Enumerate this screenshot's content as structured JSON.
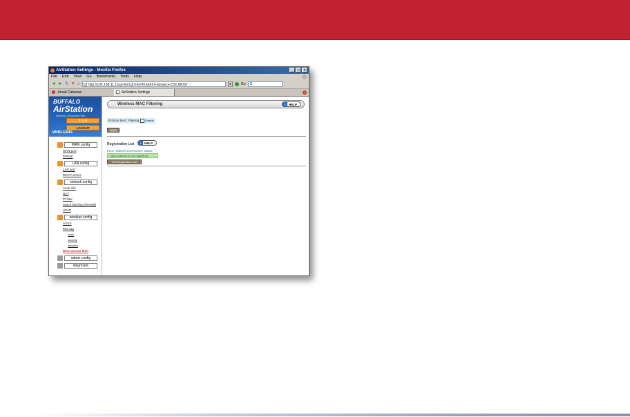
{
  "window": {
    "title": "AirStation Settings - Mozilla Firefox",
    "controls": [
      "_",
      "□",
      "×"
    ]
  },
  "menu": [
    "File",
    "Edit",
    "View",
    "Go",
    "Bookmarks",
    "Tools",
    "Help"
  ],
  "nav": {
    "back": "◄",
    "forward": "►",
    "reload": "↻",
    "stop": "✕",
    "home": "⌂",
    "url": "http://192.168.11.1/cgi-bin/cgi?req=frm&frm=advance-DSCMOST",
    "go_label": "Go",
    "search_letter": "G"
  },
  "tabs": [
    {
      "label": "Jonah Cabanas",
      "icon": "red-site-icon"
    },
    {
      "label": "AirStation Settings",
      "icon": "page-icon"
    }
  ],
  "sidebar": {
    "brand": "BUFFALO",
    "product": "AirStation",
    "tagline": "Wireless LAN Access Point",
    "top_label": "T O P",
    "logout_label": "LOGOUT",
    "model": "WHR-G54S",
    "sections": [
      {
        "label": "WAN config",
        "items": [
          "WAN port",
          "PPPoE"
        ]
      },
      {
        "label": "LAN config",
        "items": [
          "LAN port",
          "DHCP server"
        ]
      },
      {
        "label": "network config",
        "items": [
          "route info",
          "NAT",
          "IP filter",
          "attack blocking (firewall)",
          "UPnP"
        ]
      },
      {
        "label": "wireless config",
        "items": [
          "AOSS",
          "802.11g"
        ],
        "sub_items": [
          "basic",
          "security",
          "repeater"
        ],
        "active_item": "MAC access limit"
      },
      {
        "label": "admin config",
        "items": []
      },
      {
        "label": "diagnostic",
        "items": []
      }
    ]
  },
  "main": {
    "title": "Wireless MAC Filtering",
    "help": "HELP",
    "help_q": "?",
    "enforce_label": "Enforce MAC Filtering",
    "enforce_value": "Enable",
    "apply": "Apply",
    "registration_list": "Registration List",
    "status_heading": "MAC Address Connection Status",
    "status_value": "MAC Address is not registered",
    "edit_button": "Edit Registration List"
  }
}
